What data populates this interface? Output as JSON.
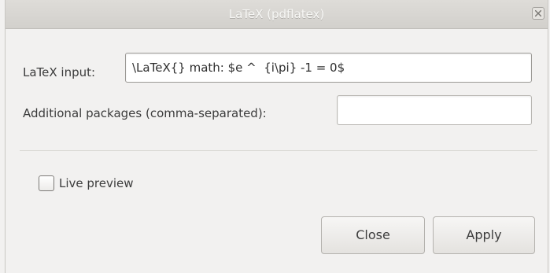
{
  "window": {
    "title": "LaTeX (pdflatex)"
  },
  "form": {
    "latex_input_label": "LaTeX input:",
    "latex_input_value": "\\LaTeX{} math: $e ^  {i\\pi} -1 = 0$",
    "packages_label": "Additional packages (comma-separated):",
    "packages_value": ""
  },
  "options": {
    "live_preview_label": "Live preview",
    "live_preview_checked": false
  },
  "buttons": {
    "close_label": "Close",
    "apply_label": "Apply"
  },
  "icons": {
    "window_close": "close-icon"
  }
}
